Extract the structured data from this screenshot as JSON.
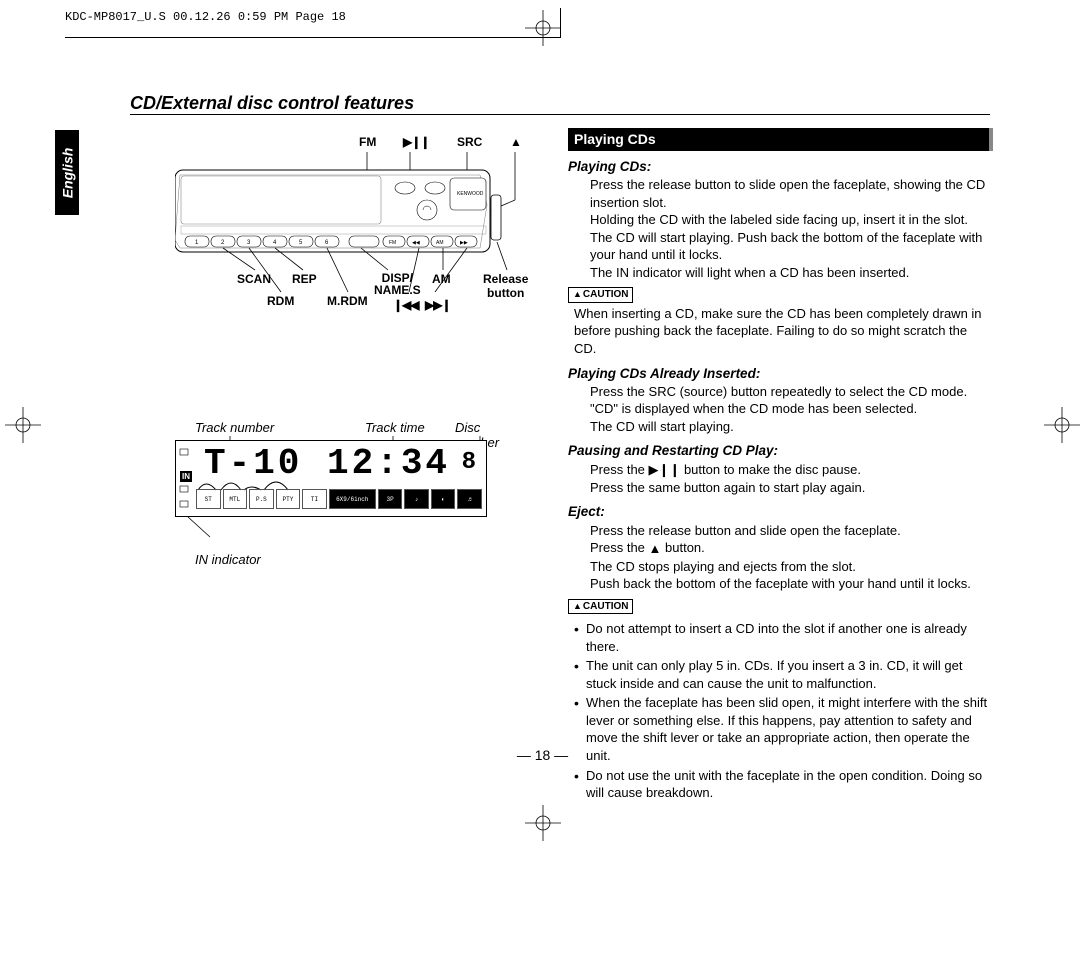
{
  "header": {
    "print_mark": "KDC-MP8017_U.S  00.12.26 0:59 PM  Page 18"
  },
  "language_tab": "English",
  "section_title": "CD/External disc control features",
  "stereo": {
    "top_labels": {
      "fm": "FM",
      "playpause": "▶❙❙",
      "src": "SRC",
      "eject": "▲"
    },
    "bottom_labels": {
      "scan": "SCAN",
      "rdm": "RDM",
      "rep": "REP",
      "mrdm": "M.RDM",
      "disp": "DISP/",
      "names": "NAME.S",
      "rew": "❙◀◀",
      "fwd": "▶▶❙",
      "am": "AM",
      "release": "Release",
      "button": "button"
    }
  },
  "display": {
    "labels": {
      "track_no": "Track number",
      "track_time": "Track time",
      "disc_no": "Disc number",
      "in_ind": "IN indicator"
    },
    "lcd": {
      "main": "T-10   12:34",
      "disc": "8",
      "in": "IN",
      "row2_a": "6X9/6inch",
      "row2_b": "3P"
    }
  },
  "right": {
    "heading": "Playing CDs",
    "s1_title": "Playing CDs:",
    "s1_p1": "Press the release button to slide open the faceplate, showing the CD insertion slot.",
    "s1_p2": "Holding the CD with the labeled side facing up, insert it in the slot. The CD will start playing. Push back the bottom of the faceplate with your hand until it locks.",
    "s1_p3": "The IN indicator will light when a CD has been inserted.",
    "caution1_label": "CAUTION",
    "caution1_text": "When inserting a CD, make sure the CD has been completely drawn in before pushing back the faceplate. Failing to do so might scratch the CD.",
    "s2_title": "Playing CDs Already Inserted:",
    "s2_p1": "Press the SRC (source) button repeatedly to select the CD mode.",
    "s2_p2": "\"CD\" is displayed when the CD mode has been selected.",
    "s2_p3": "The CD will start playing.",
    "s3_title": "Pausing and Restarting CD Play:",
    "s3_p1a": "Press the ",
    "s3_p1b": " button to make the disc pause.",
    "s3_p2": "Press the same button again to start play again.",
    "s4_title": "Eject:",
    "s4_p1": "Press the release button and slide open the faceplate.",
    "s4_p2a": "Press the ",
    "s4_p2b": " button.",
    "s4_p3": "The CD stops playing and ejects from the slot.",
    "s4_p4": "Push back the bottom of the faceplate with your hand until it locks.",
    "caution2_label": "CAUTION",
    "c2_1": "Do not attempt to insert a CD into the slot if another one is already there.",
    "c2_2": "The unit can only play 5 in. CDs. If you insert a 3 in. CD, it will get stuck inside and can cause the unit to malfunction.",
    "c2_3": "When the faceplate has been slid open, it might interfere with the shift lever or something else. If this happens, pay attention to safety and move the shift lever or take an appropriate action, then operate the unit.",
    "c2_4": "Do not use the unit with the faceplate in the open condition. Doing so will cause breakdown."
  },
  "page_number": "— 18 —"
}
